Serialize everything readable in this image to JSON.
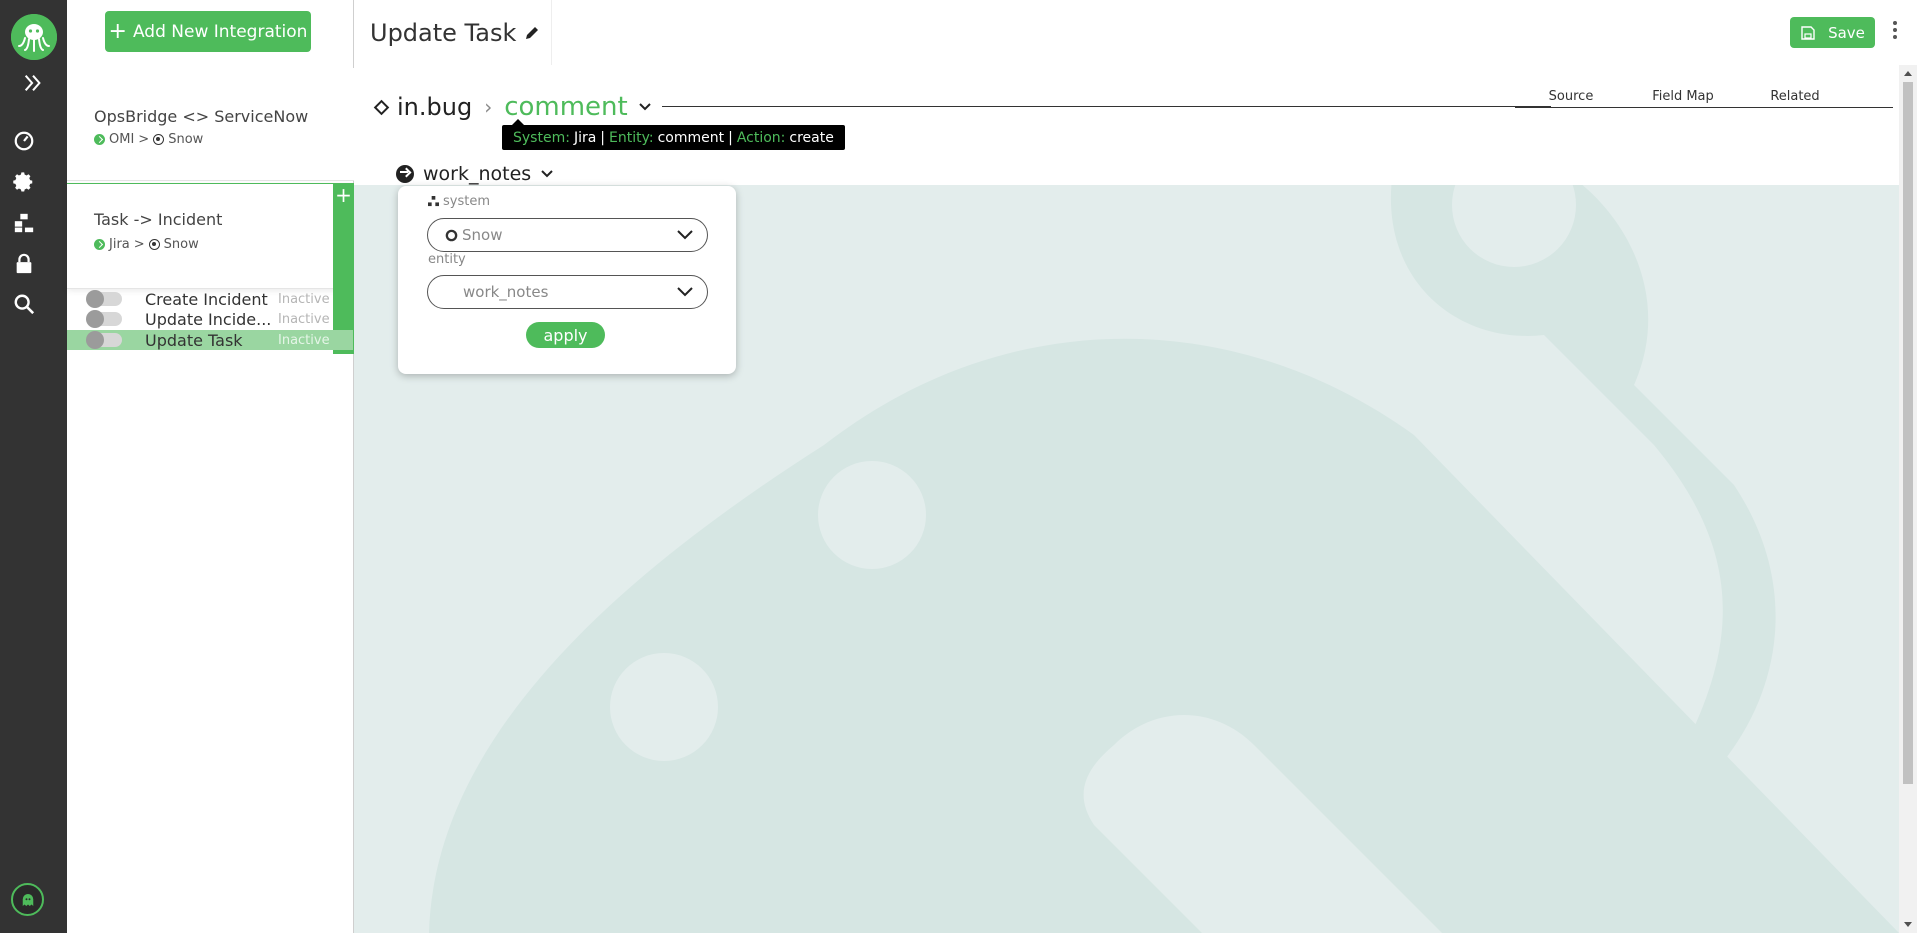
{
  "colors": {
    "brand_green": "#4ebb5b",
    "rail_bg": "#333333",
    "canvas_bg": "#e3edec"
  },
  "rail": {
    "icons": [
      "octopus-logo-icon",
      "double-chevron-right-icon",
      "dashboard-gauge-icon",
      "gear-icon",
      "hierarchy-icon",
      "lock-icon",
      "search-icon",
      "ghost-avatar-icon"
    ]
  },
  "panel": {
    "add_button": "Add New Integration",
    "integrations": [
      {
        "name": "OpsBridge <> ServiceNow",
        "source": "OMI",
        "target": "Snow"
      },
      {
        "name": "Task -> Incident",
        "source": "Jira",
        "target": "Snow"
      }
    ],
    "flows": [
      {
        "name": "Create Incident",
        "status": "Inactive"
      },
      {
        "name": "Update Incide...",
        "status": "Inactive"
      },
      {
        "name": "Update Task",
        "status": "Inactive"
      }
    ],
    "sep": ">"
  },
  "main": {
    "title": "Update Task",
    "save_label": "Save",
    "breadcrumb": {
      "root": "in.bug",
      "current": "comment"
    },
    "tabs": [
      "Source",
      "Field Map",
      "Related"
    ],
    "tooltip": {
      "system_key": "System:",
      "system_val": "Jira",
      "entity_key": "Entity:",
      "entity_val": "comment",
      "action_key": "Action:",
      "action_val": "create",
      "pipe": "|"
    },
    "field": "work_notes",
    "popup": {
      "system_label": "system",
      "system_value": "Snow",
      "entity_label": "entity",
      "entity_value": "work_notes",
      "apply_label": "apply"
    }
  }
}
